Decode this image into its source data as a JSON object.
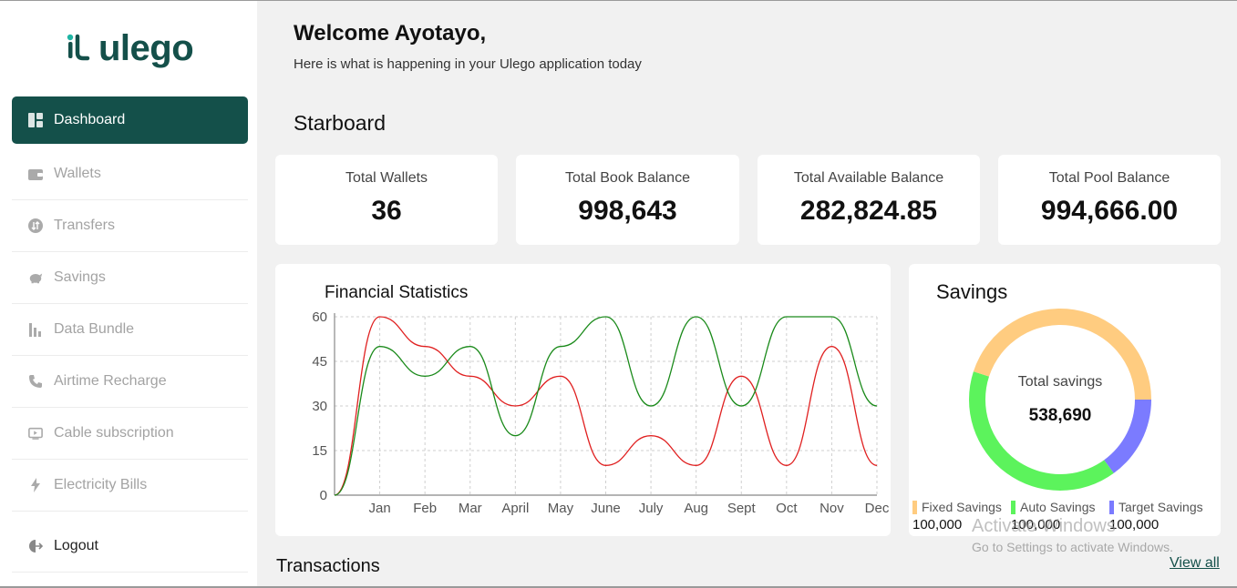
{
  "app": {
    "logo_text": "ulego"
  },
  "sidebar": {
    "items": [
      {
        "label": "Dashboard",
        "icon": "dashboard-icon",
        "active": true
      },
      {
        "label": "Wallets",
        "icon": "wallet-icon"
      },
      {
        "label": "Transfers",
        "icon": "transfer-icon"
      },
      {
        "label": "Savings",
        "icon": "piggy-bank-icon"
      },
      {
        "label": "Data Bundle",
        "icon": "bar-chart-icon"
      },
      {
        "label": "Airtime Recharge",
        "icon": "phone-icon"
      },
      {
        "label": "Cable subscription",
        "icon": "tv-icon"
      },
      {
        "label": "Electricity Bills",
        "icon": "bolt-icon"
      }
    ],
    "logout_label": "Logout"
  },
  "header": {
    "welcome": "Welcome Ayotayo,",
    "subtitle": "Here is what is happening in your Ulego application today",
    "section_title": "Starboard"
  },
  "stats": [
    {
      "label": "Total Wallets",
      "value": "36"
    },
    {
      "label": "Total Book Balance",
      "value": "998,643"
    },
    {
      "label": "Total Available Balance",
      "value": "282,824.85"
    },
    {
      "label": "Total Pool Balance",
      "value": "994,666.00"
    }
  ],
  "financial_panel": {
    "title": "Financial Statistics"
  },
  "savings_panel": {
    "title": "Savings",
    "center_label": "Total savings",
    "center_value": "538,690",
    "legend": [
      {
        "label": "Fixed Savings",
        "amount": "100,000",
        "color": "#ffcc80"
      },
      {
        "label": "Auto Savings",
        "amount": "100,000",
        "color": "#5cf35c"
      },
      {
        "label": "Target Savings",
        "amount": "100,000",
        "color": "#7b7bff"
      }
    ]
  },
  "chart_data": [
    {
      "type": "line",
      "title": "Financial Statistics",
      "x": [
        "",
        "Jan",
        "Feb",
        "Mar",
        "April",
        "May",
        "June",
        "July",
        "Aug",
        "Sept",
        "Oct",
        "Nov",
        "Dec"
      ],
      "ylim": [
        0,
        60
      ],
      "yticks": [
        0,
        15,
        30,
        45,
        60
      ],
      "grid": true,
      "series": [
        {
          "color": "#e02020",
          "values": [
            0,
            60,
            50,
            40,
            30,
            40,
            10,
            20,
            10,
            40,
            10,
            50,
            10
          ]
        },
        {
          "color": "#1a8a1a",
          "values": [
            0,
            50,
            40,
            50,
            20,
            50,
            60,
            30,
            60,
            30,
            60,
            60,
            30
          ]
        }
      ]
    },
    {
      "type": "pie",
      "title": "Savings",
      "categories": [
        "Fixed Savings",
        "Auto Savings",
        "Target Savings"
      ],
      "values": [
        45,
        40,
        15
      ],
      "colors": [
        "#ffcc80",
        "#5cf35c",
        "#7b7bff"
      ]
    }
  ],
  "transactions": {
    "title": "Transactions",
    "view_all": "View all"
  },
  "watermark": {
    "line1": "Activate Windows",
    "line2": "Go to Settings to activate Windows."
  }
}
